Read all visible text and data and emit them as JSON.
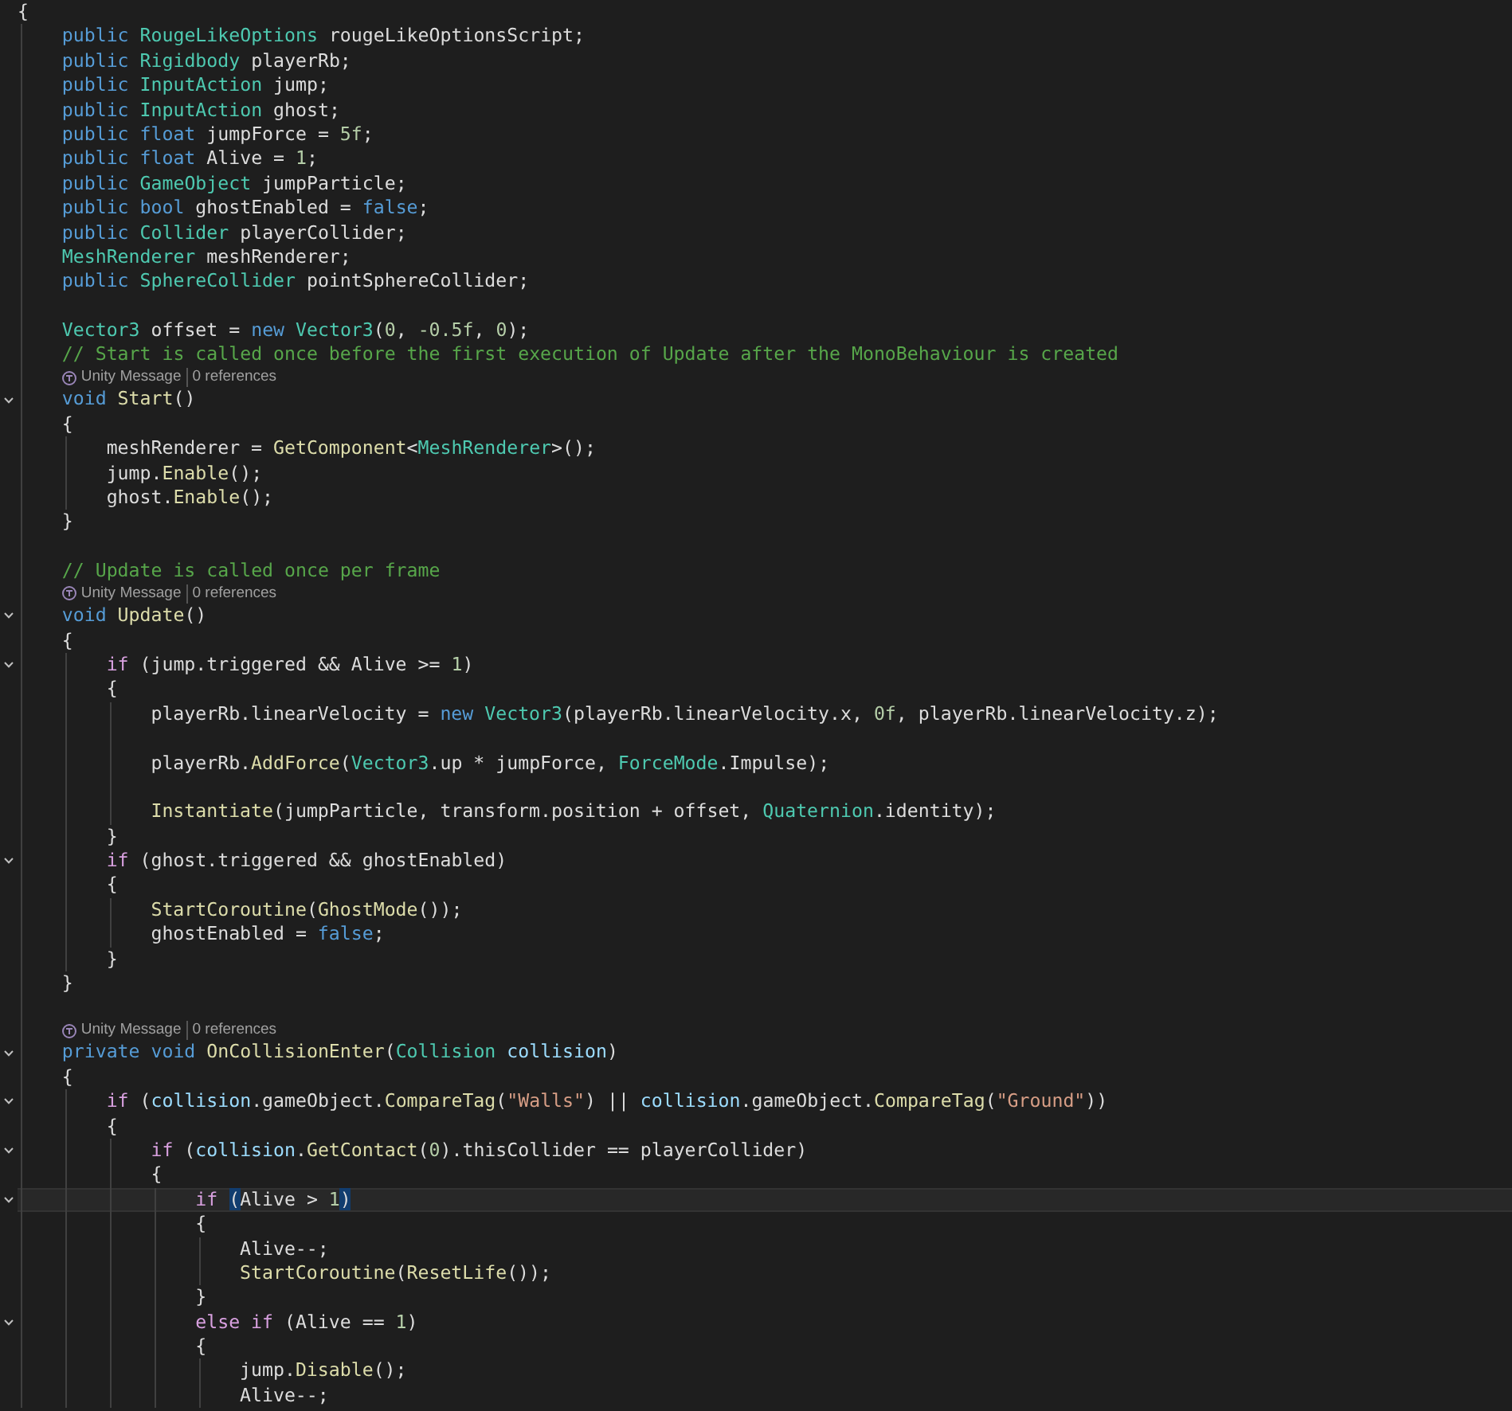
{
  "editor": {
    "lines": [
      {
        "kind": "code",
        "fold": false,
        "current": false,
        "tokens": [
          {
            "kind": "tx",
            "text": "{"
          }
        ],
        "children": [
          {
            "kind": "code",
            "fold": false,
            "current": false,
            "tokens": [
              {
                "kind": "kw",
                "text": "public"
              },
              {
                "kind": "type",
                "text": " RougeLikeOptions"
              },
              {
                "kind": "tx",
                "text": " rougeLikeOptionsScript;"
              }
            ]
          },
          {
            "kind": "code",
            "fold": false,
            "current": false,
            "tokens": [
              {
                "kind": "kw",
                "text": "public"
              },
              {
                "kind": "type",
                "text": " Rigidbody"
              },
              {
                "kind": "tx",
                "text": " playerRb;"
              }
            ]
          },
          {
            "kind": "code",
            "fold": false,
            "current": false,
            "tokens": [
              {
                "kind": "kw",
                "text": "public"
              },
              {
                "kind": "type",
                "text": " InputAction"
              },
              {
                "kind": "tx",
                "text": " jump;"
              }
            ]
          },
          {
            "kind": "code",
            "fold": false,
            "current": false,
            "tokens": [
              {
                "kind": "kw",
                "text": "public"
              },
              {
                "kind": "type",
                "text": " InputAction"
              },
              {
                "kind": "tx",
                "text": " ghost;"
              }
            ]
          },
          {
            "kind": "code",
            "fold": false,
            "current": false,
            "tokens": [
              {
                "kind": "kw",
                "text": "public float"
              },
              {
                "kind": "tx",
                "text": " jumpForce = "
              },
              {
                "kind": "num",
                "text": "5f"
              },
              {
                "kind": "tx",
                "text": ";"
              }
            ]
          },
          {
            "kind": "code",
            "fold": false,
            "current": false,
            "tokens": [
              {
                "kind": "kw",
                "text": "public float"
              },
              {
                "kind": "tx",
                "text": " Alive = "
              },
              {
                "kind": "num",
                "text": "1"
              },
              {
                "kind": "tx",
                "text": ";"
              }
            ]
          },
          {
            "kind": "code",
            "fold": false,
            "current": false,
            "tokens": [
              {
                "kind": "kw",
                "text": "public"
              },
              {
                "kind": "type",
                "text": " GameObject"
              },
              {
                "kind": "tx",
                "text": " jumpParticle;"
              }
            ]
          },
          {
            "kind": "code",
            "fold": false,
            "current": false,
            "tokens": [
              {
                "kind": "kw",
                "text": "public bool"
              },
              {
                "kind": "tx",
                "text": " ghostEnabled = "
              },
              {
                "kind": "kw",
                "text": "false"
              },
              {
                "kind": "tx",
                "text": ";"
              }
            ]
          },
          {
            "kind": "code",
            "fold": false,
            "current": false,
            "tokens": [
              {
                "kind": "kw",
                "text": "public"
              },
              {
                "kind": "type",
                "text": " Collider"
              },
              {
                "kind": "tx",
                "text": " playerCollider;"
              }
            ]
          },
          {
            "kind": "code",
            "fold": false,
            "current": false,
            "tokens": [
              {
                "kind": "type",
                "text": "MeshRenderer"
              },
              {
                "kind": "tx",
                "text": " meshRenderer;"
              }
            ]
          },
          {
            "kind": "code",
            "fold": false,
            "current": false,
            "tokens": [
              {
                "kind": "kw",
                "text": "public"
              },
              {
                "kind": "type",
                "text": " SphereCollider"
              },
              {
                "kind": "tx",
                "text": " pointSphereCollider;"
              }
            ]
          },
          {
            "kind": "blank"
          },
          {
            "kind": "code",
            "fold": false,
            "current": false,
            "tokens": [
              {
                "kind": "type",
                "text": "Vector3"
              },
              {
                "kind": "tx",
                "text": " offset = "
              },
              {
                "kind": "kw",
                "text": "new"
              },
              {
                "kind": "type",
                "text": " Vector3"
              },
              {
                "kind": "tx",
                "text": "("
              },
              {
                "kind": "num",
                "text": "0"
              },
              {
                "kind": "tx",
                "text": ", "
              },
              {
                "kind": "num",
                "text": "-0.5f"
              },
              {
                "kind": "tx",
                "text": ", "
              },
              {
                "kind": "num",
                "text": "0"
              },
              {
                "kind": "tx",
                "text": ");"
              }
            ]
          },
          {
            "kind": "code",
            "fold": false,
            "current": false,
            "tokens": [
              {
                "kind": "cm",
                "text": "// Start is called once before the first execution of Update after the MonoBehaviour is created"
              }
            ]
          },
          {
            "kind": "lens",
            "source": "Unity Message",
            "refs": "0 references"
          },
          {
            "kind": "code",
            "fold": true,
            "current": false,
            "tokens": [
              {
                "kind": "kw",
                "text": "void"
              },
              {
                "kind": "fn",
                "text": " Start"
              },
              {
                "kind": "tx",
                "text": "()"
              }
            ]
          },
          {
            "kind": "code",
            "fold": false,
            "current": false,
            "tokens": [
              {
                "kind": "tx",
                "text": "{"
              }
            ],
            "children": [
              {
                "kind": "code",
                "fold": false,
                "current": false,
                "tokens": [
                  {
                    "kind": "tx",
                    "text": "meshRenderer = "
                  },
                  {
                    "kind": "fn",
                    "text": "GetComponent"
                  },
                  {
                    "kind": "tx",
                    "text": "<"
                  },
                  {
                    "kind": "type",
                    "text": "MeshRenderer"
                  },
                  {
                    "kind": "tx",
                    "text": ">();"
                  }
                ]
              },
              {
                "kind": "code",
                "fold": false,
                "current": false,
                "tokens": [
                  {
                    "kind": "tx",
                    "text": "jump."
                  },
                  {
                    "kind": "fn",
                    "text": "Enable"
                  },
                  {
                    "kind": "tx",
                    "text": "();"
                  }
                ]
              },
              {
                "kind": "code",
                "fold": false,
                "current": false,
                "tokens": [
                  {
                    "kind": "tx",
                    "text": "ghost."
                  },
                  {
                    "kind": "fn",
                    "text": "Enable"
                  },
                  {
                    "kind": "tx",
                    "text": "();"
                  }
                ]
              }
            ]
          },
          {
            "kind": "code",
            "fold": false,
            "current": false,
            "tokens": [
              {
                "kind": "tx",
                "text": "}"
              }
            ]
          },
          {
            "kind": "blank"
          },
          {
            "kind": "code",
            "fold": false,
            "current": false,
            "tokens": [
              {
                "kind": "cm",
                "text": "// Update is called once per frame"
              }
            ]
          },
          {
            "kind": "lens",
            "source": "Unity Message",
            "refs": "0 references"
          },
          {
            "kind": "code",
            "fold": true,
            "current": false,
            "tokens": [
              {
                "kind": "kw",
                "text": "void"
              },
              {
                "kind": "fn",
                "text": " Update"
              },
              {
                "kind": "tx",
                "text": "()"
              }
            ]
          },
          {
            "kind": "code",
            "fold": false,
            "current": false,
            "tokens": [
              {
                "kind": "tx",
                "text": "{"
              }
            ],
            "children": [
              {
                "kind": "code",
                "fold": true,
                "current": false,
                "tokens": [
                  {
                    "kind": "ctl",
                    "text": "if"
                  },
                  {
                    "kind": "tx",
                    "text": " (jump.triggered && Alive >= "
                  },
                  {
                    "kind": "num",
                    "text": "1"
                  },
                  {
                    "kind": "tx",
                    "text": ")"
                  }
                ]
              },
              {
                "kind": "code",
                "fold": false,
                "current": false,
                "tokens": [
                  {
                    "kind": "tx",
                    "text": "{"
                  }
                ],
                "children": [
                  {
                    "kind": "code",
                    "fold": false,
                    "current": false,
                    "tokens": [
                      {
                        "kind": "tx",
                        "text": "playerRb.linearVelocity = "
                      },
                      {
                        "kind": "kw",
                        "text": "new"
                      },
                      {
                        "kind": "type",
                        "text": " Vector3"
                      },
                      {
                        "kind": "tx",
                        "text": "(playerRb.linearVelocity.x, "
                      },
                      {
                        "kind": "num",
                        "text": "0f"
                      },
                      {
                        "kind": "tx",
                        "text": ", playerRb.linearVelocity.z);"
                      }
                    ]
                  },
                  {
                    "kind": "blank"
                  },
                  {
                    "kind": "code",
                    "fold": false,
                    "current": false,
                    "tokens": [
                      {
                        "kind": "tx",
                        "text": "playerRb."
                      },
                      {
                        "kind": "fn",
                        "text": "AddForce"
                      },
                      {
                        "kind": "tx",
                        "text": "("
                      },
                      {
                        "kind": "type",
                        "text": "Vector3"
                      },
                      {
                        "kind": "tx",
                        "text": ".up * jumpForce, "
                      },
                      {
                        "kind": "type",
                        "text": "ForceMode"
                      },
                      {
                        "kind": "tx",
                        "text": ".Impulse);"
                      }
                    ]
                  },
                  {
                    "kind": "blank"
                  },
                  {
                    "kind": "code",
                    "fold": false,
                    "current": false,
                    "tokens": [
                      {
                        "kind": "fn",
                        "text": "Instantiate"
                      },
                      {
                        "kind": "tx",
                        "text": "(jumpParticle, transform.position + offset, "
                      },
                      {
                        "kind": "type",
                        "text": "Quaternion"
                      },
                      {
                        "kind": "tx",
                        "text": ".identity);"
                      }
                    ]
                  }
                ]
              },
              {
                "kind": "code",
                "fold": false,
                "current": false,
                "tokens": [
                  {
                    "kind": "tx",
                    "text": "}"
                  }
                ]
              },
              {
                "kind": "code",
                "fold": true,
                "current": false,
                "tokens": [
                  {
                    "kind": "ctl",
                    "text": "if"
                  },
                  {
                    "kind": "tx",
                    "text": " (ghost.triggered && ghostEnabled)"
                  }
                ]
              },
              {
                "kind": "code",
                "fold": false,
                "current": false,
                "tokens": [
                  {
                    "kind": "tx",
                    "text": "{"
                  }
                ],
                "children": [
                  {
                    "kind": "code",
                    "fold": false,
                    "current": false,
                    "tokens": [
                      {
                        "kind": "fn",
                        "text": "StartCoroutine"
                      },
                      {
                        "kind": "tx",
                        "text": "("
                      },
                      {
                        "kind": "fn",
                        "text": "GhostMode"
                      },
                      {
                        "kind": "tx",
                        "text": "());"
                      }
                    ]
                  },
                  {
                    "kind": "code",
                    "fold": false,
                    "current": false,
                    "tokens": [
                      {
                        "kind": "tx",
                        "text": "ghostEnabled = "
                      },
                      {
                        "kind": "kw",
                        "text": "false"
                      },
                      {
                        "kind": "tx",
                        "text": ";"
                      }
                    ]
                  }
                ]
              },
              {
                "kind": "code",
                "fold": false,
                "current": false,
                "tokens": [
                  {
                    "kind": "tx",
                    "text": "}"
                  }
                ]
              }
            ]
          },
          {
            "kind": "code",
            "fold": false,
            "current": false,
            "tokens": [
              {
                "kind": "tx",
                "text": "}"
              }
            ]
          },
          {
            "kind": "blank"
          },
          {
            "kind": "lens",
            "source": "Unity Message",
            "refs": "0 references"
          },
          {
            "kind": "code",
            "fold": true,
            "current": false,
            "tokens": [
              {
                "kind": "kw",
                "text": "private void"
              },
              {
                "kind": "fn",
                "text": " OnCollisionEnter"
              },
              {
                "kind": "tx",
                "text": "("
              },
              {
                "kind": "type",
                "text": "Collision"
              },
              {
                "kind": "par",
                "text": " collision"
              },
              {
                "kind": "tx",
                "text": ")"
              }
            ]
          },
          {
            "kind": "code",
            "fold": false,
            "current": false,
            "tokens": [
              {
                "kind": "tx",
                "text": "{"
              }
            ],
            "children": [
              {
                "kind": "code",
                "fold": true,
                "current": false,
                "tokens": [
                  {
                    "kind": "ctl",
                    "text": "if"
                  },
                  {
                    "kind": "tx",
                    "text": " ("
                  },
                  {
                    "kind": "par",
                    "text": "collision"
                  },
                  {
                    "kind": "tx",
                    "text": ".gameObject."
                  },
                  {
                    "kind": "fn",
                    "text": "CompareTag"
                  },
                  {
                    "kind": "tx",
                    "text": "("
                  },
                  {
                    "kind": "str",
                    "text": "\"Walls\""
                  },
                  {
                    "kind": "tx",
                    "text": ") || "
                  },
                  {
                    "kind": "par",
                    "text": "collision"
                  },
                  {
                    "kind": "tx",
                    "text": ".gameObject."
                  },
                  {
                    "kind": "fn",
                    "text": "CompareTag"
                  },
                  {
                    "kind": "tx",
                    "text": "("
                  },
                  {
                    "kind": "str",
                    "text": "\"Ground\""
                  },
                  {
                    "kind": "tx",
                    "text": "))"
                  }
                ]
              },
              {
                "kind": "code",
                "fold": false,
                "current": false,
                "tokens": [
                  {
                    "kind": "tx",
                    "text": "{"
                  }
                ],
                "children": [
                  {
                    "kind": "code",
                    "fold": true,
                    "current": false,
                    "tokens": [
                      {
                        "kind": "ctl",
                        "text": "if"
                      },
                      {
                        "kind": "tx",
                        "text": " ("
                      },
                      {
                        "kind": "par",
                        "text": "collision"
                      },
                      {
                        "kind": "tx",
                        "text": "."
                      },
                      {
                        "kind": "fn",
                        "text": "GetContact"
                      },
                      {
                        "kind": "tx",
                        "text": "("
                      },
                      {
                        "kind": "num",
                        "text": "0"
                      },
                      {
                        "kind": "tx",
                        "text": ").thisCollider == playerCollider)"
                      }
                    ]
                  },
                  {
                    "kind": "code",
                    "fold": false,
                    "current": false,
                    "tokens": [
                      {
                        "kind": "tx",
                        "text": "{"
                      }
                    ],
                    "children": [
                      {
                        "kind": "code",
                        "fold": true,
                        "current": true,
                        "tokens": [
                          {
                            "kind": "ctl",
                            "text": "if"
                          },
                          {
                            "kind": "br",
                            "text": " ("
                          },
                          {
                            "kind": "tx",
                            "text": "Alive > "
                          },
                          {
                            "kind": "num",
                            "text": "1"
                          },
                          {
                            "kind": "br",
                            "text": ")"
                          }
                        ]
                      },
                      {
                        "kind": "code",
                        "fold": false,
                        "current": false,
                        "tokens": [
                          {
                            "kind": "tx",
                            "text": "{"
                          }
                        ],
                        "children": [
                          {
                            "kind": "code",
                            "fold": false,
                            "current": false,
                            "tokens": [
                              {
                                "kind": "tx",
                                "text": "Alive--;"
                              }
                            ]
                          },
                          {
                            "kind": "code",
                            "fold": false,
                            "current": false,
                            "tokens": [
                              {
                                "kind": "fn",
                                "text": "StartCoroutine"
                              },
                              {
                                "kind": "tx",
                                "text": "("
                              },
                              {
                                "kind": "fn",
                                "text": "ResetLife"
                              },
                              {
                                "kind": "tx",
                                "text": "());"
                              }
                            ]
                          }
                        ]
                      },
                      {
                        "kind": "code",
                        "fold": false,
                        "current": false,
                        "tokens": [
                          {
                            "kind": "tx",
                            "text": "}"
                          }
                        ]
                      },
                      {
                        "kind": "code",
                        "fold": true,
                        "current": false,
                        "tokens": [
                          {
                            "kind": "ctl",
                            "text": "else if"
                          },
                          {
                            "kind": "tx",
                            "text": " (Alive == "
                          },
                          {
                            "kind": "num",
                            "text": "1"
                          },
                          {
                            "kind": "tx",
                            "text": ")"
                          }
                        ]
                      },
                      {
                        "kind": "code",
                        "fold": false,
                        "current": false,
                        "tokens": [
                          {
                            "kind": "tx",
                            "text": "{"
                          }
                        ],
                        "children": [
                          {
                            "kind": "code",
                            "fold": false,
                            "current": false,
                            "tokens": [
                              {
                                "kind": "tx",
                                "text": "jump."
                              },
                              {
                                "kind": "fn",
                                "text": "Disable"
                              },
                              {
                                "kind": "tx",
                                "text": "();"
                              }
                            ]
                          },
                          {
                            "kind": "code",
                            "fold": false,
                            "current": false,
                            "tokens": [
                              {
                                "kind": "tx",
                                "text": "Alive--;"
                              }
                            ]
                          }
                        ]
                      }
                    ]
                  }
                ]
              }
            ]
          }
        ]
      }
    ]
  }
}
